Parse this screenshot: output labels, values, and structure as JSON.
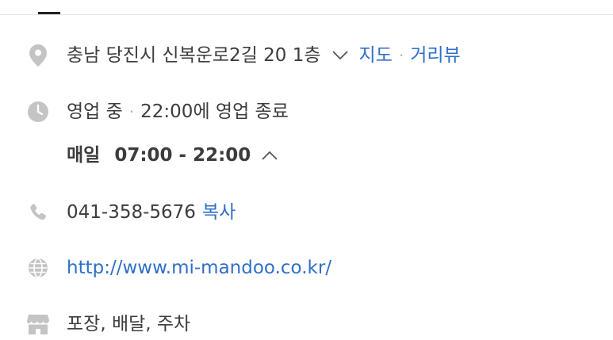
{
  "address": {
    "text": "충남 당진시 신복운로2길 20 1층",
    "map_label": "지도",
    "roadview_label": "거리뷰",
    "separator": "·"
  },
  "hours": {
    "status": "영업 중",
    "separator": "·",
    "closing": "22:00에 영업 종료",
    "day": "매일",
    "time": "07:00 - 22:00"
  },
  "phone": {
    "number": "041-358-5676",
    "copy_label": "복사"
  },
  "website": {
    "url": "http://www.mi-mandoo.co.kr/"
  },
  "amenities": {
    "text": "포장, 배달, 주차"
  },
  "colors": {
    "link": "#2f6ec8",
    "icon": "#c4c4c4",
    "text": "#3c3c3c",
    "separator": "#b5b5b5"
  },
  "icons": {
    "address": "location-pin-icon",
    "hours": "clock-icon",
    "phone": "phone-icon",
    "website": "globe-icon",
    "amenities": "store-icon",
    "address_toggle": "chevron-down-icon",
    "hours_toggle": "chevron-up-icon"
  }
}
